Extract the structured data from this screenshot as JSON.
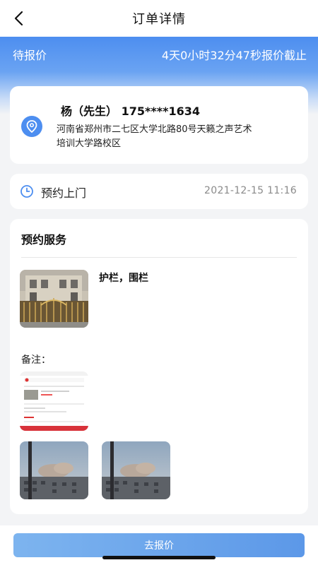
{
  "header": {
    "title": "订单详情"
  },
  "banner": {
    "status": "待报价",
    "deadline": "4天0小时32分47秒报价截止"
  },
  "address": {
    "name_phone": "杨（先生） 175****1634",
    "address": "河南省郑州市二七区大学北路80号天籁之声艺术培训大学路校区"
  },
  "appointment": {
    "label": "预约上门",
    "time": "2021-12-15 11:16"
  },
  "service": {
    "section_title": "预约服务",
    "item_name": "护栏，围栏",
    "note_label": "备注："
  },
  "footer": {
    "quote_button": "去报价"
  },
  "colors": {
    "accent": "#4d8ef0",
    "button_start": "#7db4ef",
    "button_end": "#5c98e8"
  }
}
